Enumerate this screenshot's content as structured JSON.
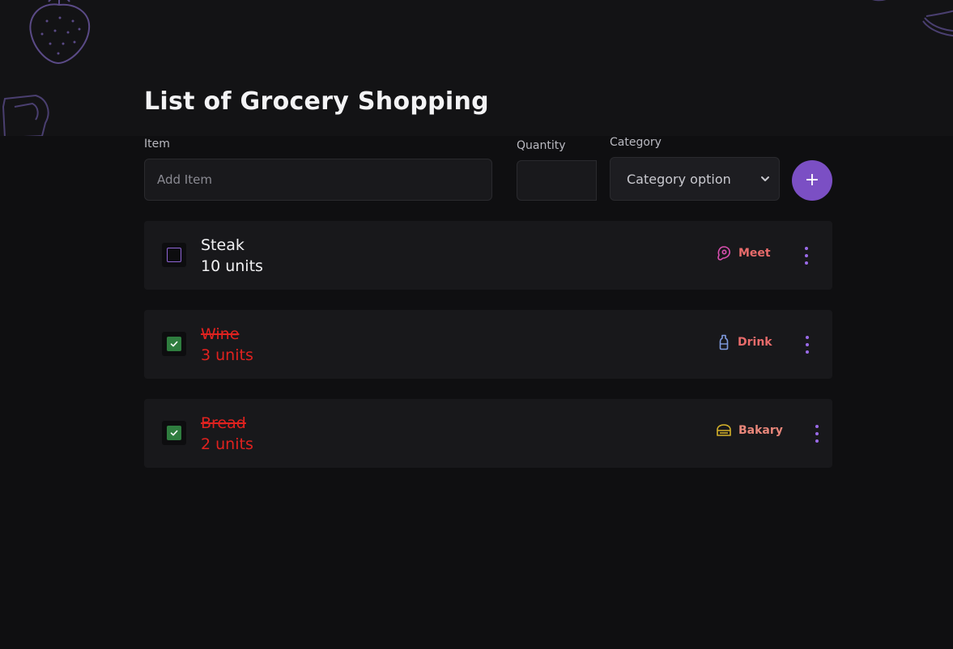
{
  "page": {
    "title": "List of Grocery Shopping"
  },
  "form": {
    "item_label": "Item",
    "item_placeholder": "Add Item",
    "quantity_label": "Quantity",
    "quantity_value": "",
    "category_label": "Category",
    "category_selected": "Category option",
    "add_button": "+"
  },
  "items": [
    {
      "name": "Steak",
      "units": "10 units",
      "checked": false,
      "category": "Meet",
      "category_icon": "meat-icon",
      "category_color": "#e86b6b",
      "icon_color": "#d94fb0"
    },
    {
      "name": "Wine",
      "units": "3 units",
      "checked": true,
      "category": "Drink",
      "category_icon": "bottle-icon",
      "category_color": "#e86b6b",
      "icon_color": "#7f9be0"
    },
    {
      "name": "Bread",
      "units": "2 units",
      "checked": true,
      "category": "Bakary",
      "category_icon": "bread-icon",
      "category_color": "#e8867a",
      "icon_color": "#d4b12a"
    }
  ],
  "colors": {
    "accent": "#7b4fc4",
    "checked": "#2f7d3f",
    "done_text": "#e0221f",
    "background": "#0f0f11",
    "row": "#18181b"
  }
}
